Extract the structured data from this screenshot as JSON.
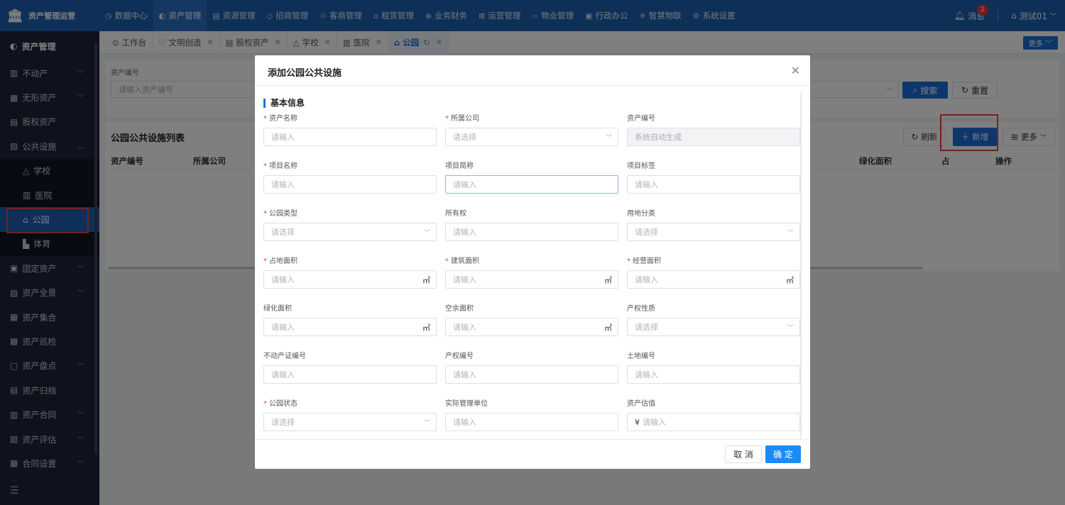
{
  "brand": {
    "title": "资产管理运营"
  },
  "topnav": [
    {
      "icon": "◷",
      "label": "数据中心"
    },
    {
      "icon": "◐",
      "label": "资产管理",
      "active": true
    },
    {
      "icon": "▤",
      "label": "资源管理"
    },
    {
      "icon": "◇",
      "label": "招商管理"
    },
    {
      "icon": "♲",
      "label": "客商管理"
    },
    {
      "icon": "⌂",
      "label": "租赁管理"
    },
    {
      "icon": "⊕",
      "label": "业务财务"
    },
    {
      "icon": "⊠",
      "label": "运营管理"
    },
    {
      "icon": "⌓",
      "label": "物业管理"
    },
    {
      "icon": "▣",
      "label": "行政办公"
    },
    {
      "icon": "✳",
      "label": "智慧物联"
    },
    {
      "icon": "⚙",
      "label": "系统设置"
    }
  ],
  "topright": {
    "message_label": "消息",
    "message_count": "2",
    "user_name": "测试01"
  },
  "sidebar": {
    "header": "资产管理",
    "items": [
      {
        "icon": "▥",
        "label": "不动产",
        "chev": "﹀"
      },
      {
        "icon": "▦",
        "label": "无形资产",
        "chev": "﹀"
      },
      {
        "icon": "▤",
        "label": "股权资产",
        "chev": ""
      },
      {
        "icon": "▧",
        "label": "公共设施",
        "chev": "︿"
      }
    ],
    "sub_items": [
      {
        "icon": "△",
        "label": "学校"
      },
      {
        "icon": "▥",
        "label": "医院"
      },
      {
        "icon": "⌂",
        "label": "公园",
        "active": true
      },
      {
        "icon": "▙",
        "label": "体育"
      }
    ],
    "items_after": [
      {
        "icon": "▣",
        "label": "固定资产",
        "chev": "﹀"
      },
      {
        "icon": "▨",
        "label": "资产全景",
        "chev": "﹀"
      },
      {
        "icon": "▦",
        "label": "资产集合",
        "chev": ""
      },
      {
        "icon": "▩",
        "label": "资产巡检",
        "chev": ""
      },
      {
        "icon": "▢",
        "label": "资产盘点",
        "chev": "﹀"
      },
      {
        "icon": "▤",
        "label": "资产归档",
        "chev": ""
      },
      {
        "icon": "▥",
        "label": "资产合同",
        "chev": "﹀"
      },
      {
        "icon": "▧",
        "label": "资产评估",
        "chev": "﹀"
      },
      {
        "icon": "▦",
        "label": "合同设置",
        "chev": "﹀"
      }
    ],
    "collapse_icon": "☰"
  },
  "tabs": [
    {
      "icon": "⊙",
      "label": "工作台",
      "closable": false
    },
    {
      "icon": "♡",
      "label": "文明创造",
      "closable": true
    },
    {
      "icon": "▤",
      "label": "股权资产",
      "closable": true
    },
    {
      "icon": "△",
      "label": "学校",
      "closable": true
    },
    {
      "icon": "▥",
      "label": "医院",
      "closable": true
    },
    {
      "icon": "⌂",
      "label": "公园",
      "closable": true,
      "active": true
    }
  ],
  "tabs_more": "更多",
  "search": {
    "label": "资产编号",
    "placeholder": "请输入资产编号",
    "search_btn": "搜索",
    "reset_btn": "重置"
  },
  "list": {
    "title": "公园公共设施列表",
    "refresh_btn": "刷新",
    "add_btn": "新增",
    "more_btn": "更多",
    "columns": [
      "资产编号",
      "所属公司",
      "绿化面积",
      "占",
      "操作"
    ]
  },
  "modal": {
    "title": "添加公园公共设施",
    "section": "基本信息",
    "fields": [
      {
        "label": "资产名称",
        "required": true,
        "placeholder": "请输入",
        "type": "input"
      },
      {
        "label": "所属公司",
        "required": true,
        "placeholder": "请选择",
        "type": "select"
      },
      {
        "label": "资产编号",
        "required": false,
        "placeholder": "系统自动生成",
        "type": "disabled"
      },
      {
        "label": "项目名称",
        "required": true,
        "placeholder": "请输入",
        "type": "input"
      },
      {
        "label": "项目简称",
        "required": false,
        "placeholder": "请输入",
        "type": "focus"
      },
      {
        "label": "项目标签",
        "required": false,
        "placeholder": "请输入",
        "type": "input"
      },
      {
        "label": "公园类型",
        "required": true,
        "placeholder": "请选择",
        "type": "select"
      },
      {
        "label": "所有权",
        "required": false,
        "placeholder": "请输入",
        "type": "input"
      },
      {
        "label": "用地分类",
        "required": false,
        "placeholder": "请选择",
        "type": "select"
      },
      {
        "label": "占地面积",
        "required": true,
        "placeholder": "请输入",
        "type": "unit",
        "unit": "㎡"
      },
      {
        "label": "建筑面积",
        "required": true,
        "placeholder": "请输入",
        "type": "unit",
        "unit": "㎡"
      },
      {
        "label": "经营面积",
        "required": true,
        "placeholder": "请输入",
        "type": "unit",
        "unit": "㎡"
      },
      {
        "label": "绿化面积",
        "required": false,
        "placeholder": "请输入",
        "type": "unit",
        "unit": "㎡"
      },
      {
        "label": "空余面积",
        "required": false,
        "placeholder": "请输入",
        "type": "unit",
        "unit": "㎡"
      },
      {
        "label": "产权性质",
        "required": false,
        "placeholder": "请选择",
        "type": "select"
      },
      {
        "label": "不动产证编号",
        "required": false,
        "placeholder": "请输入",
        "type": "input"
      },
      {
        "label": "产权编号",
        "required": false,
        "placeholder": "请输入",
        "type": "input"
      },
      {
        "label": "土地编号",
        "required": false,
        "placeholder": "请输入",
        "type": "input"
      },
      {
        "label": "公园状态",
        "required": true,
        "placeholder": "请选择",
        "type": "select"
      },
      {
        "label": "实际管理单位",
        "required": false,
        "placeholder": "请输入",
        "type": "input"
      },
      {
        "label": "资产估值",
        "required": false,
        "placeholder": "请输入",
        "type": "prefix",
        "prefix": "¥"
      }
    ],
    "cancel_btn": "取 消",
    "ok_btn": "确 定"
  },
  "colors": {
    "primary": "#1b6fd6",
    "topbar": "#1b5fb0",
    "sidebar": "#1c2438",
    "highlight": "#e54545"
  }
}
